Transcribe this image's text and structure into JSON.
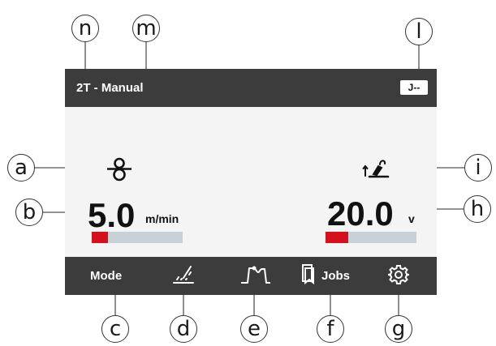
{
  "header": {
    "mode": "2T - Manual",
    "job_badge": "J--"
  },
  "left_parameter": {
    "icon": "wire-feed-icon",
    "value": "5.0",
    "unit": "m/min",
    "level": 0.18
  },
  "right_parameter": {
    "icon": "torch-voltage-icon",
    "value": "20.0",
    "unit": "v",
    "level": 0.25
  },
  "menu": {
    "mode_label": "Mode",
    "jobs_label": "Jobs",
    "icons": [
      "welding-process-icon",
      "pulse-waveform-icon",
      "jobs-icon",
      "gear-icon"
    ]
  },
  "callouts": [
    "n",
    "m",
    "l",
    "a",
    "b",
    "i",
    "h",
    "c",
    "d",
    "e",
    "f",
    "g"
  ],
  "colors": {
    "bar_background": "#3c3c3c",
    "screen_background": "#f4f4f4",
    "level_fill": "#d6101a",
    "level_track": "#c8d1d8"
  }
}
